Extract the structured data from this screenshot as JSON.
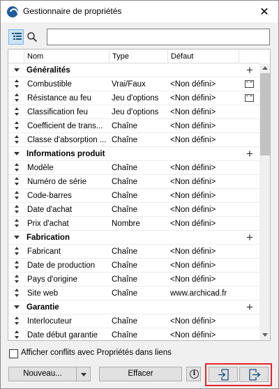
{
  "window": {
    "title": "Gestionnaire de propriétés"
  },
  "toolbar": {
    "search_value": "",
    "search_placeholder": ""
  },
  "table": {
    "columns": [
      "Nom",
      "Type",
      "Défaut"
    ],
    "groups": [
      {
        "name": "Généralités",
        "rows": [
          {
            "name": "Combustible",
            "type": "Vrai/Faux",
            "default": "<Non défini>",
            "options_icon": true
          },
          {
            "name": "Résistance au feu",
            "type": "Jeu d'options",
            "default": "<Non défini>",
            "options_icon": true
          },
          {
            "name": "Classification feu",
            "type": "Jeu d'options",
            "default": "<Non défini>",
            "options_icon": false
          },
          {
            "name": "Coefficient de trans...",
            "type": "Chaîne",
            "default": "<Non défini>",
            "options_icon": false
          },
          {
            "name": "Classe d'absorption ...",
            "type": "Chaîne",
            "default": "<Non défini>",
            "options_icon": false
          }
        ]
      },
      {
        "name": "Informations produit",
        "rows": [
          {
            "name": "Modèle",
            "type": "Chaîne",
            "default": "<Non défini>",
            "options_icon": false
          },
          {
            "name": "Numéro de série",
            "type": "Chaîne",
            "default": "<Non défini>",
            "options_icon": false
          },
          {
            "name": "Code-barres",
            "type": "Chaîne",
            "default": "<Non défini>",
            "options_icon": false
          },
          {
            "name": "Date d'achat",
            "type": "Chaîne",
            "default": "<Non défini>",
            "options_icon": false
          },
          {
            "name": "Prix d'achat",
            "type": "Nombre",
            "default": "<Non défini>",
            "options_icon": false
          }
        ]
      },
      {
        "name": "Fabrication",
        "rows": [
          {
            "name": "Fabricant",
            "type": "Chaîne",
            "default": "<Non défini>",
            "options_icon": false
          },
          {
            "name": "Date de production",
            "type": "Chaîne",
            "default": "<Non défini>",
            "options_icon": false
          },
          {
            "name": "Pays d'origine",
            "type": "Chaîne",
            "default": "<Non défini>",
            "options_icon": false
          },
          {
            "name": "Site web",
            "type": "Chaîne",
            "default": "www.archicad.fr",
            "options_icon": false
          }
        ]
      },
      {
        "name": "Garantie",
        "rows": [
          {
            "name": "Interlocuteur",
            "type": "Chaîne",
            "default": "<Non défini>",
            "options_icon": false
          },
          {
            "name": "Date début garantie",
            "type": "Chaîne",
            "default": "<Non défini>",
            "options_icon": false
          }
        ]
      }
    ]
  },
  "footer": {
    "checkbox_label": "Afficher conflits avec Propriétés dans liens",
    "checkbox_checked": false,
    "new_button": "Nouveau...",
    "clear_button": "Effacer",
    "info_button": "i"
  },
  "icons": {
    "app": "archicad-icon",
    "close": "close-icon",
    "list_view": "list-view-icon",
    "search": "search-icon",
    "import": "import-icon",
    "export": "export-icon"
  },
  "colors": {
    "highlight_border": "#e8232b",
    "selected_toggle": "#cce4f7",
    "app_icon": "#1f5e9e"
  }
}
